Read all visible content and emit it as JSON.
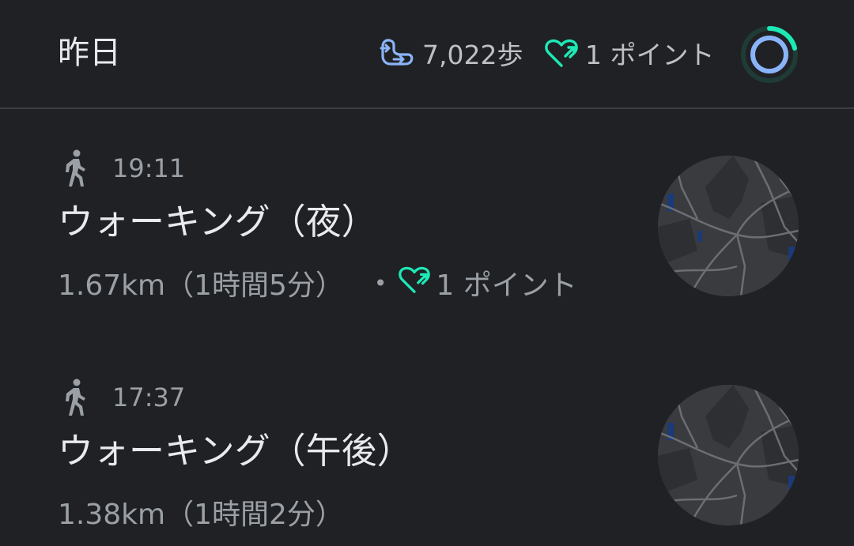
{
  "header": {
    "title": "昨日",
    "steps": "7,022歩",
    "heart_points": "1 ポイント",
    "steps_icon": "steps-icon",
    "heart_icon": "heart-points-icon",
    "ring_icon": "daily-goal-ring"
  },
  "colors": {
    "background": "#202124",
    "divider": "#3c4043",
    "steps_blue": "#8ab4f8",
    "heart_teal": "#1de9b6",
    "primary_text": "#e8eaed",
    "secondary_text": "#9aa0a6"
  },
  "activities": [
    {
      "icon": "walking-icon",
      "time": "19:11",
      "title": "ウォーキング（夜）",
      "summary": "1.67km（1時間5分）",
      "separator": "•",
      "points": "1 ポイント"
    },
    {
      "icon": "walking-icon",
      "time": "17:37",
      "title": "ウォーキング（午後）",
      "summary": "1.38km（1時間2分）"
    }
  ]
}
